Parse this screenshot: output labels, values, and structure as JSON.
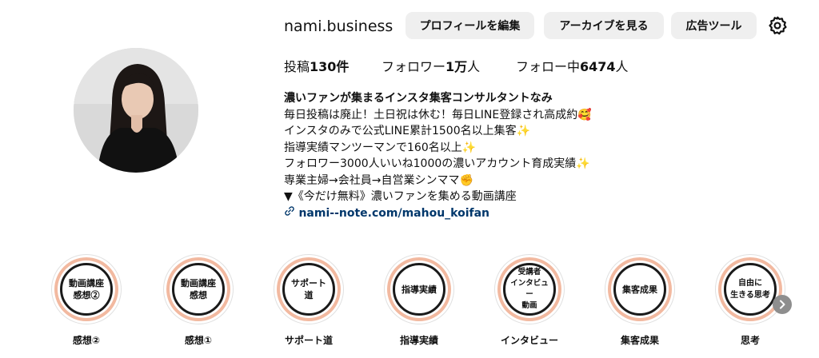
{
  "profile": {
    "username": "nami.business",
    "buttons": {
      "edit": "プロフィールを編集",
      "archive": "アーカイブを見る",
      "ads": "広告ツール"
    },
    "stats": {
      "posts_label": "投稿",
      "posts_value": "130件",
      "followers_label": "フォロワー",
      "followers_value": "1万",
      "followers_suffix": "人",
      "following_label": "フォロー中",
      "following_value": "6474",
      "following_suffix": "人"
    },
    "bio": {
      "name": "濃いファンが集まるインスタ集客コンサルタントなみ",
      "lines": [
        "毎日投稿は廃止！土日祝は休む！毎日LINE登録され高成約🥰",
        "インスタのみで公式LINE累計1500名以上集客✨",
        "指導実績マンツーマンで160名以上✨",
        "フォロワー3000人いいね1000の濃いアカウント育成実績✨",
        "専業主婦→会社員→自営業シンママ✊",
        "▼《今だけ無料》濃いファンを集める動画講座"
      ],
      "link": "nami--note.com/mahou_koifan"
    }
  },
  "highlights": [
    {
      "cover": "動画講座\n感想②",
      "label": "感想②"
    },
    {
      "cover": "動画講座\n感想",
      "label": "感想①"
    },
    {
      "cover": "サポート\n道",
      "label": "サポート道"
    },
    {
      "cover": "指導実績",
      "label": "指導実績"
    },
    {
      "cover": "受講者\nインタビュー\n動画",
      "label": "インタビュー"
    },
    {
      "cover": "集客成果",
      "label": "集客成果"
    },
    {
      "cover": "自由に\n生きる思考",
      "label": "思考"
    }
  ],
  "icons": {
    "settings": "gear-icon",
    "link": "link-icon",
    "next": "chevron-right-icon"
  },
  "colors": {
    "button_bg": "#efefef",
    "link": "#00376b",
    "highlight_ring": "#f2b9a0"
  }
}
